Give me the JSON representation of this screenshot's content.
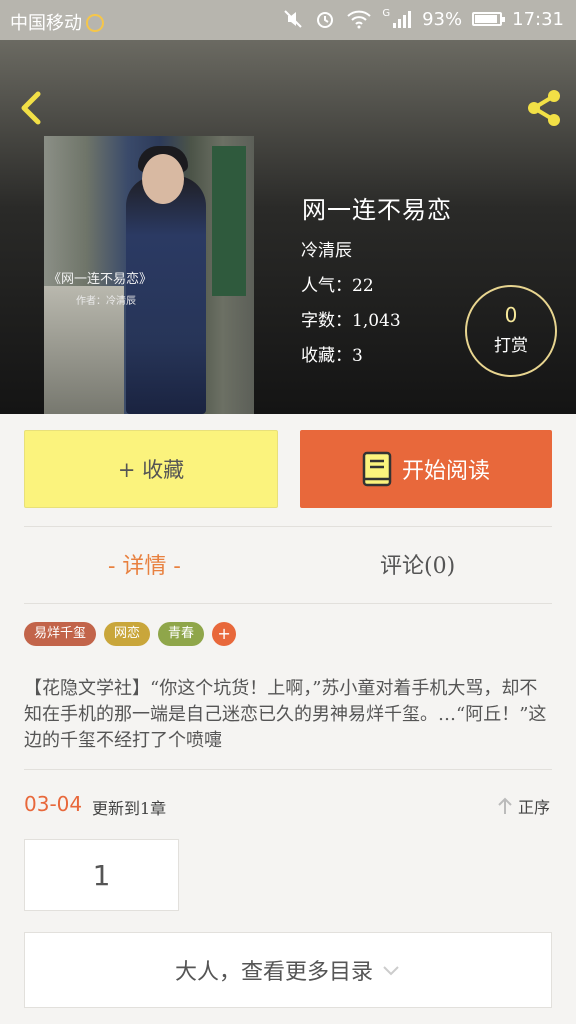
{
  "status_bar": {
    "carrier": "中国移动",
    "signal_label": "G",
    "battery_percent": "93%",
    "battery_level": 0.93,
    "time": "17:31"
  },
  "book": {
    "title": "网一连不易恋",
    "author": "冷清辰",
    "popularity": "人气：22",
    "word_count": "字数：1,043",
    "favorites": "收藏：3",
    "cover_title": "《网一连不易恋》",
    "cover_author": "作者：冷清辰"
  },
  "reward": {
    "count": "0",
    "label": "打赏"
  },
  "actions": {
    "favorite_label": "+ 收藏",
    "read_label": "开始阅读"
  },
  "tabs": {
    "detail": "- 详情 -",
    "comments": "评论(0)"
  },
  "tags": [
    {
      "label": "易烊千玺",
      "color": "#c2644a"
    },
    {
      "label": "网恋",
      "color": "#c9a63b"
    },
    {
      "label": "青春",
      "color": "#8fa64a"
    }
  ],
  "description": "【花隐文学社】“你这个坑货！上啊，”苏小童对着手机大骂，却不知在手机的那一端是自己迷恋已久的男神易烊千玺。…“阿丘！”这边的千玺不经打了个喷嚏",
  "update": {
    "date": "03-04",
    "text": "更新到1章",
    "sort_label": "正序"
  },
  "chapters": [
    "1"
  ],
  "more_label": "大人，查看更多目录",
  "colors": {
    "accent": "#e8683b",
    "favorite_bg": "#fbf37d",
    "tab_active": "#e8803f"
  }
}
